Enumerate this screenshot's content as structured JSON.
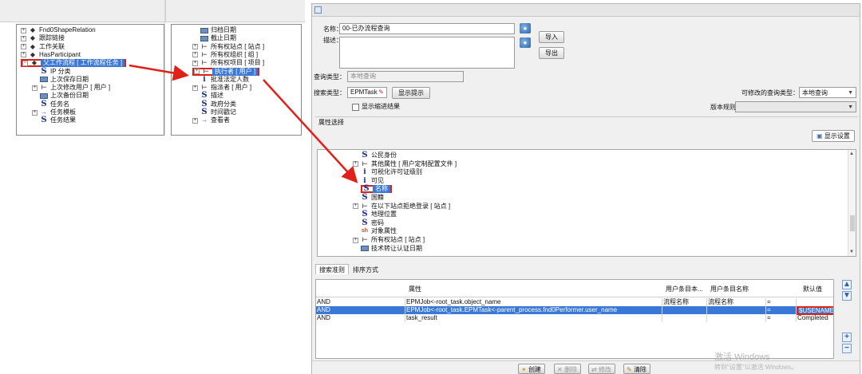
{
  "left_tree": {
    "items": [
      {
        "label": "Fnd0ShapeRelation",
        "icon": "diamond-icon"
      },
      {
        "label": "跟踪链接",
        "icon": "diamond-icon"
      },
      {
        "label": "工作关联",
        "icon": "diamond-icon"
      },
      {
        "label": "HasParticipant",
        "icon": "diamond-icon"
      },
      {
        "label": "父工作流程 [ 工作流程任务 ]",
        "icon": "diamond-icon"
      },
      {
        "label": "IP 分类",
        "icon": "string-attr-icon"
      },
      {
        "label": "上次保存日期",
        "icon": "date-attr-icon"
      },
      {
        "label": "上次修改用户 [ 用户 ]",
        "icon": "typed-ref-icon"
      },
      {
        "label": "上次备份日期",
        "icon": "date-attr-icon"
      },
      {
        "label": "任务名",
        "icon": "string-attr-icon"
      },
      {
        "label": "任务模板",
        "icon": "ref-arrow-icon"
      },
      {
        "label": "任务结果",
        "icon": "string-attr-icon"
      }
    ]
  },
  "mid_tree": {
    "items": [
      {
        "label": "归档日期",
        "icon": "date-attr-icon"
      },
      {
        "label": "截止日期",
        "icon": "date-attr-icon"
      },
      {
        "label": "所有权站点 [ 站点 ]",
        "icon": "typed-ref-icon"
      },
      {
        "label": "所有权组织 [ 组 ]",
        "icon": "typed-ref-icon"
      },
      {
        "label": "所有权项目 [ 项目 ]",
        "icon": "typed-ref-icon"
      },
      {
        "label": "执行者 [ 用户 ]",
        "icon": "typed-ref-icon"
      },
      {
        "label": "批准法定人数",
        "icon": "int-attr-icon"
      },
      {
        "label": "指派者 [ 用户 ]",
        "icon": "typed-ref-icon"
      },
      {
        "label": "描述",
        "icon": "string-attr-icon"
      },
      {
        "label": "政府分类",
        "icon": "string-attr-icon"
      },
      {
        "label": "时间戳记",
        "icon": "string-attr-icon"
      },
      {
        "label": "查看者",
        "icon": "ref-arrow-icon"
      }
    ]
  },
  "form": {
    "name_label": "名称：",
    "name_value": "00-已办流程查询",
    "desc_label": "描述：",
    "desc_value": "",
    "import_button": "导入",
    "export_button": "导出",
    "query_type_label": "查询类型：",
    "query_type_value": "本地查询",
    "search_type_label": "搜索类型：",
    "search_type_value": "EPMTask",
    "show_hint_button": "显示提示",
    "show_progressive_label": "显示缩进结果",
    "modifiable_type_label": "可修改的查询类型：",
    "modifiable_type_value": "本地查询",
    "version_rule_label": "版本规则：",
    "version_rule_value": ""
  },
  "attr_section": {
    "label": "属性选择",
    "show_settings_button": "显示设置",
    "items": [
      {
        "label": "公民身份",
        "icon": "string-attr-icon"
      },
      {
        "label": "其他属性 [ 用户定制配置文件 ]",
        "icon": "typed-ref-icon"
      },
      {
        "label": "可税化许可证级别",
        "icon": "int-attr-icon"
      },
      {
        "label": "可见",
        "icon": "int-attr-icon"
      },
      {
        "label": "名称",
        "icon": "string-attr-icon"
      },
      {
        "label": "国籍",
        "icon": "string-attr-icon"
      },
      {
        "label": "在以下站点拒绝登录 [ 站点 ]",
        "icon": "typed-ref-icon"
      },
      {
        "label": "地理位置",
        "icon": "string-attr-icon"
      },
      {
        "label": "密码",
        "icon": "string-attr-icon"
      },
      {
        "label": "对象属性",
        "icon": "sh-attr-icon"
      },
      {
        "label": "所有权站点 [ 站点 ]",
        "icon": "typed-ref-icon"
      },
      {
        "label": "技术转让认证日期",
        "icon": "date-attr-icon"
      }
    ]
  },
  "tabs": [
    {
      "label": "搜索准则",
      "active": true
    },
    {
      "label": "排序方式",
      "active": false
    }
  ],
  "grid": {
    "headers": [
      "",
      "属性",
      "用户条目本...",
      "用户条目名称",
      "",
      "默认值"
    ],
    "rows": [
      {
        "logic": "AND",
        "attr": "EPMJob<-root_task.object_name",
        "ue_l10n": "流程名称",
        "ue_name": "流程名称",
        "op": "=",
        "default": ""
      },
      {
        "logic": "AND",
        "attr": "EPMJob<-root_task.EPMTask<-parent_process.fnd0Performer.user_name",
        "ue_l10n": "",
        "ue_name": "",
        "op": "=",
        "default": "$USENAME"
      },
      {
        "logic": "AND",
        "attr": "task_result",
        "ue_l10n": "",
        "ue_name": "",
        "op": "=",
        "default": "Completed"
      }
    ]
  },
  "bottom": {
    "create": "创建",
    "delete": "删除",
    "modify": "修改",
    "clear": "清除"
  },
  "watermark": {
    "line1": "激活 Windows",
    "line2": "转到\"设置\"以激活 Windows。"
  },
  "colors": {
    "highlight": "#e0211a",
    "selection": "#3a78d8"
  }
}
